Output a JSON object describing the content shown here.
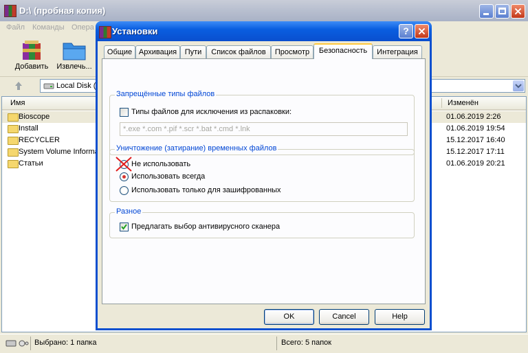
{
  "main": {
    "title": "D:\\ (пробная копия)",
    "menu": [
      "Файл",
      "Команды",
      "Опера"
    ],
    "toolbar": {
      "add_label": "Добавить",
      "extract_label": "Извлечь..."
    },
    "address": {
      "value": "Local Disk (D"
    },
    "columns": {
      "name": "Имя",
      "modified": "Изменён"
    },
    "files": [
      {
        "name": "Bioscope",
        "modified": "01.06.2019 2:26",
        "selected": true
      },
      {
        "name": "Install",
        "modified": "01.06.2019 19:54"
      },
      {
        "name": "RECYCLER",
        "modified": "15.12.2017 16:40"
      },
      {
        "name": "System Volume Informa",
        "modified": "15.12.2017 17:11"
      },
      {
        "name": "Статьи",
        "modified": "01.06.2019 20:21"
      }
    ],
    "status": {
      "selected": "Выбрано: 1 папка",
      "total": "Всего: 5 папок"
    }
  },
  "dialog": {
    "title": "Установки",
    "tabs": [
      "Общие",
      "Архивация",
      "Пути",
      "Список файлов",
      "Просмотр",
      "Безопасность",
      "Интеграция"
    ],
    "active_tab": "Безопасность",
    "forbidden_group": {
      "label": "Запрещённые типы файлов",
      "checkbox_label": "Типы файлов для исключения из распаковки:",
      "checked": false,
      "input_value": "*.exe *.com *.pif *.scr *.bat *.cmd *.lnk"
    },
    "wipe_group": {
      "label": "Уничтожение (затирание) временных файлов",
      "options": [
        "Не использовать",
        "Использовать всегда",
        "Использовать только для зашифрованных"
      ],
      "selected_option": "Использовать всегда"
    },
    "misc_group": {
      "label": "Разное",
      "checkbox_label": "Предлагать выбор антивирусного сканера",
      "checked": true
    },
    "buttons": {
      "ok": "OK",
      "cancel": "Cancel",
      "help": "Help"
    }
  },
  "colors": {
    "dialog_title": "#0A4FCF",
    "group_label": "#0046D5",
    "selection": "#ECE9D8"
  }
}
